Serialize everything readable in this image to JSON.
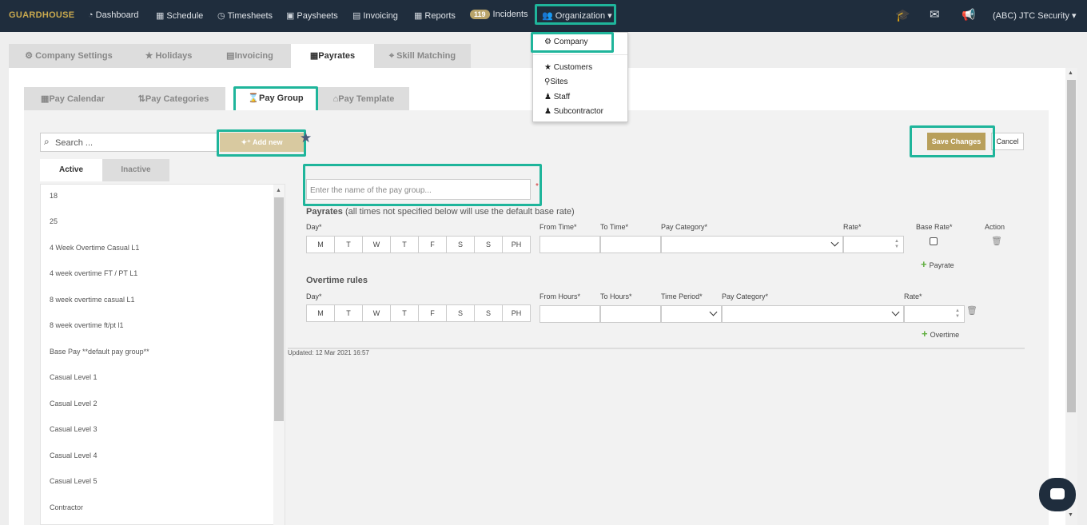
{
  "brand": "GUARDHOUSE",
  "nav": {
    "dashboard": "Dashboard",
    "schedule": "Schedule",
    "timesheets": "Timesheets",
    "paysheets": "Paysheets",
    "invoicing": "Invoicing",
    "reports": "Reports",
    "incidents_count": "119",
    "incidents": "Incidents",
    "organization": "Organization"
  },
  "account": "(ABC) JTC Security",
  "org_menu": {
    "company": "Company",
    "customers": "Customers",
    "sites": "Sites",
    "staff": "Staff",
    "subcontractor": "Subcontractor"
  },
  "tabs_main": [
    "Company Settings",
    "Holidays",
    "Invoicing",
    "Payrates",
    "Skill Matching"
  ],
  "tabs_sub": [
    "Pay Calendar",
    "Pay Categories",
    "Pay Group",
    "Pay Template"
  ],
  "search": {
    "placeholder": "Search ..."
  },
  "add_new": "Add new",
  "list_tabs": {
    "active": "Active",
    "inactive": "Inactive"
  },
  "pay_groups": [
    "18",
    "25",
    "4 Week Overtime Casual L1",
    "4 week overtime FT / PT L1",
    "8 week overtime casual L1",
    "8 week overtime ft/pt l1",
    "Base Pay **default pay group**",
    "Casual Level 1",
    "Casual Level 2",
    "Casual Level 3",
    "Casual Level 4",
    "Casual Level 5",
    "Contractor"
  ],
  "actions": {
    "save": "Save Changes",
    "cancel": "Cancel"
  },
  "form": {
    "name_placeholder": "Enter the name of the pay group...",
    "required_mark": "*"
  },
  "payrates": {
    "title": "Payrates",
    "subtitle": "(all times not specified below will use the default base rate)",
    "day": "Day*",
    "from_time": "From Time*",
    "to_time": "To Time*",
    "pay_category": "Pay Category*",
    "rate": "Rate*",
    "base_rate": "Base Rate*",
    "action": "Action",
    "add": "Payrate"
  },
  "days": [
    "M",
    "T",
    "W",
    "T",
    "F",
    "S",
    "S",
    "PH"
  ],
  "overtime": {
    "title": "Overtime rules",
    "day": "Day*",
    "from_hours": "From Hours*",
    "to_hours": "To Hours*",
    "time_period": "Time Period*",
    "pay_category": "Pay Category*",
    "rate": "Rate*",
    "add": "Overtime"
  },
  "updated": "Updated: 12 Mar 2021 16:57"
}
